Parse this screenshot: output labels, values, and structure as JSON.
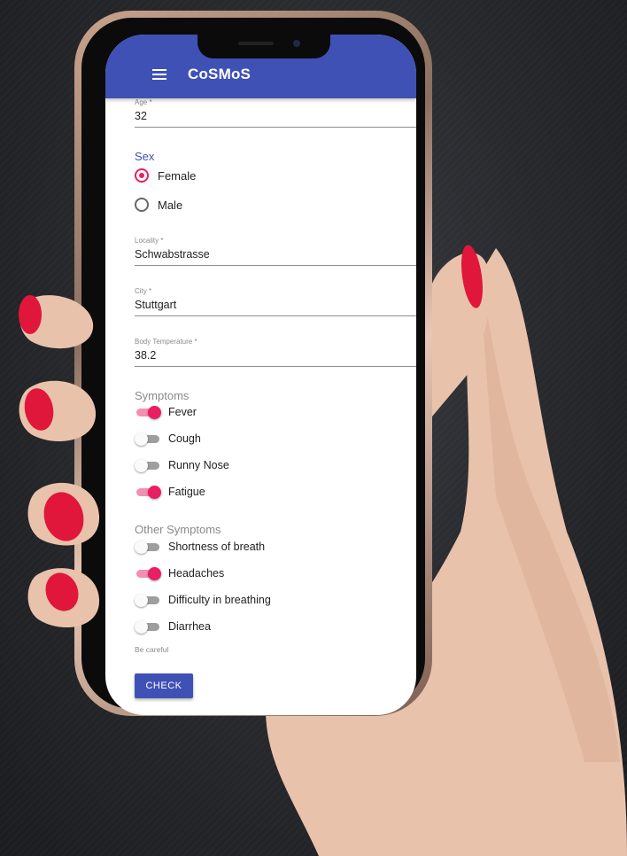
{
  "app": {
    "title": "CoSMoS"
  },
  "form": {
    "age": {
      "label": "Age *",
      "value": "32"
    },
    "sex": {
      "title": "Sex",
      "options": [
        {
          "label": "Female",
          "selected": true
        },
        {
          "label": "Male",
          "selected": false
        }
      ]
    },
    "locality": {
      "label": "Locality *",
      "value": "Schwabstrasse"
    },
    "city": {
      "label": "City *",
      "value": "Stuttgart"
    },
    "temperature": {
      "label": "Body Temperature *",
      "value": "38.2"
    },
    "symptoms": {
      "title": "Symptoms",
      "items": [
        {
          "label": "Fever",
          "on": true
        },
        {
          "label": "Cough",
          "on": false
        },
        {
          "label": "Runny Nose",
          "on": false
        },
        {
          "label": "Fatigue",
          "on": true
        }
      ]
    },
    "other_symptoms": {
      "title": "Other Symptoms",
      "items": [
        {
          "label": "Shortness of breath",
          "on": false
        },
        {
          "label": "Headaches",
          "on": true
        },
        {
          "label": "Difficulty in breathing",
          "on": false
        },
        {
          "label": "Diarrhea",
          "on": false
        }
      ],
      "hint": "Be careful"
    },
    "check_button": "CHECK"
  },
  "colors": {
    "primary": "#3f51b5",
    "accent": "#e91e63",
    "nail": "#e0163b"
  }
}
